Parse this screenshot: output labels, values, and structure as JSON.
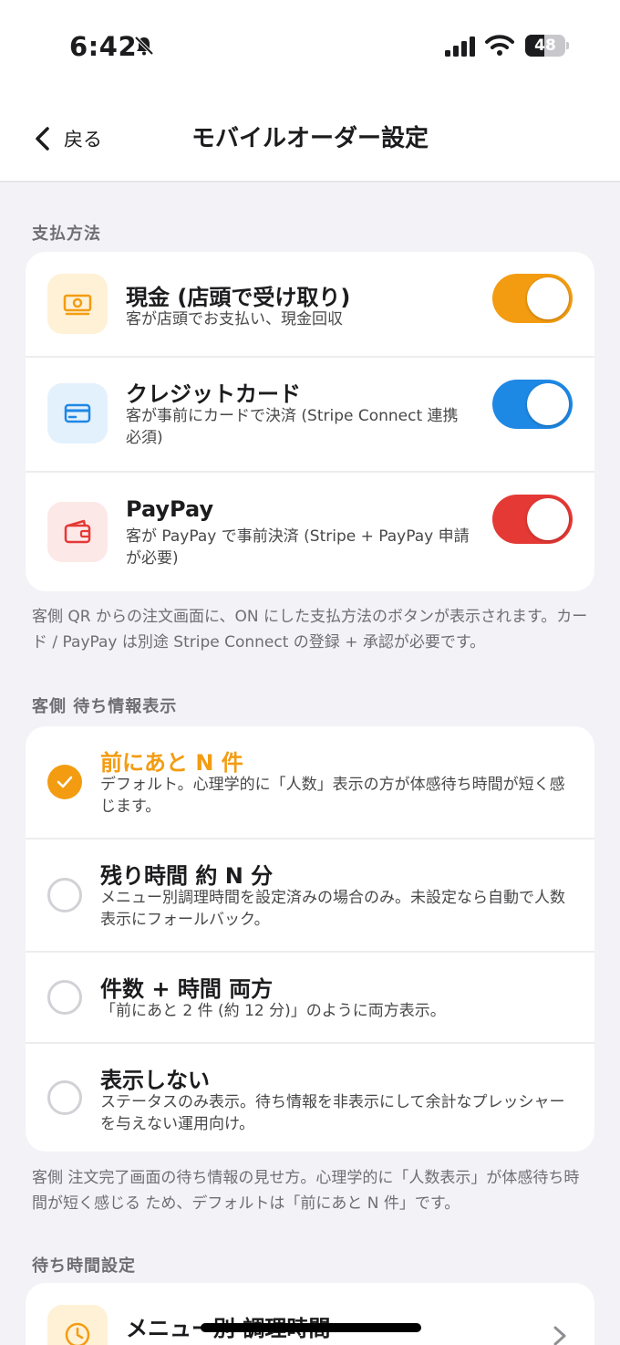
{
  "status_bar": {
    "time": "6:42",
    "battery_level": "48",
    "battery_fraction": 0.48,
    "icons": [
      "bell-slash-icon",
      "cellular-signal-icon",
      "wifi-icon",
      "battery-icon"
    ]
  },
  "nav": {
    "back_label": "戻る",
    "title": "モバイルオーダー設定"
  },
  "payment": {
    "header": "支払方法",
    "methods": [
      {
        "title": "現金 (店頭で受け取り)",
        "desc": "客が店頭でお支払い、現金回収",
        "enabled": true,
        "icon": "cash-icon",
        "toggle_color": "#f39c12",
        "icon_bg": "#fff1d6"
      },
      {
        "title": "クレジットカード",
        "desc": "客が事前にカードで決済 (Stripe Connect 連携必須)",
        "enabled": true,
        "icon": "credit-card-icon",
        "toggle_color": "#1e88e5",
        "icon_bg": "#e3f1fd"
      },
      {
        "title": "PayPay",
        "desc": "客が PayPay で事前決済 (Stripe + PayPay 申請が必要)",
        "enabled": true,
        "icon": "wallet-icon",
        "toggle_color": "#e53935",
        "icon_bg": "#fde8e8"
      }
    ],
    "footnote": "客側 QR からの注文画面に、ON にした支払方法のボタンが表示されます。カード / PayPay は別途 Stripe Connect の登録 + 承認が必要です。"
  },
  "wait_display": {
    "header": "客側 待ち情報表示",
    "options": [
      {
        "title": "前にあと N 件",
        "desc": "デフォルト。心理学的に「人数」表示の方が体感待ち時間が短く感じます。",
        "selected": true
      },
      {
        "title": "残り時間 約 N 分",
        "desc": "メニュー別調理時間を設定済みの場合のみ。未設定なら自動で人数表示にフォールバック。",
        "selected": false
      },
      {
        "title": "件数 + 時間 両方",
        "desc": "「前にあと 2 件 (約 12 分)」のように両方表示。",
        "selected": false
      },
      {
        "title": "表示しない",
        "desc": "ステータスのみ表示。待ち情報を非表示にして余計なプレッシャーを与えない運用向け。",
        "selected": false
      }
    ],
    "footnote": "客側 注文完了画面の待ち情報の見せ方。心理学的に「人数表示」が体感待ち時間が短く感じる ため、デフォルトは「前にあと N 件」です。"
  },
  "wait_time": {
    "header": "待ち時間設定",
    "menu_item": {
      "title": "メニュー別 調理時間",
      "icon": "clock-icon"
    }
  },
  "colors": {
    "accent": "#f39c12",
    "card_blue": "#1e88e5",
    "paypay_red": "#e53935"
  }
}
